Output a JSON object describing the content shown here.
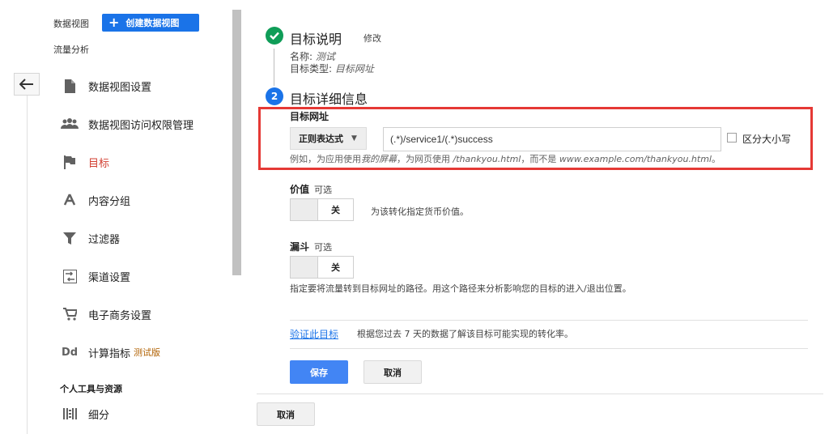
{
  "sidebar": {
    "view_label": "数据视图",
    "create_view_label": "创建数据视图",
    "view_name": "流量分析",
    "items": [
      {
        "label": "数据视图设置",
        "icon": "document-icon"
      },
      {
        "label": "数据视图访问权限管理",
        "icon": "people-icon"
      },
      {
        "label": "目标",
        "icon": "flag-icon"
      },
      {
        "label": "内容分组",
        "icon": "person-walk-icon"
      },
      {
        "label": "过滤器",
        "icon": "filter-icon"
      },
      {
        "label": "渠道设置",
        "icon": "channel-settings-icon"
      },
      {
        "label": "电子商务设置",
        "icon": "cart-icon"
      },
      {
        "label": "计算指标",
        "icon": "dd-icon",
        "badge": "测试版"
      }
    ],
    "personal_section_title": "个人工具与资源",
    "personal_items": [
      {
        "label": "细分",
        "icon": "segments-icon"
      }
    ]
  },
  "goal_description": {
    "title": "目标说明",
    "edit_label": "修改",
    "name_label": "名称:",
    "name_value": "测试",
    "type_label": "目标类型:",
    "type_value": "目标网址"
  },
  "goal_details": {
    "step_number": "2",
    "title": "目标详细信息",
    "destination_label": "目标网址",
    "match_type": "正则表达式",
    "destination_value": "(.*)/service1/(.*)success",
    "case_sensitive_label": "区分大小写",
    "hint_prefix": "例如，为应用使用",
    "hint_app": "我的屏幕",
    "hint_mid": "，为网页使用",
    "hint_page": "/thankyou.html",
    "hint_not": "，而不是",
    "hint_full": "www.example.com/thankyou.html",
    "hint_end": "。",
    "value_label": "价值",
    "value_optional": "可选",
    "value_toggle": "关",
    "value_desc": "为该转化指定货币价值。",
    "funnel_label": "漏斗",
    "funnel_optional": "可选",
    "funnel_toggle": "关",
    "funnel_desc": "指定要将流量转到目标网址的路径。用这个路径来分析影响您的目标的进入/退出位置。",
    "verify_label": "验证此目标",
    "verify_desc": "根据您过去 7 天的数据了解该目标可能实现的转化率。",
    "save_label": "保存",
    "cancel_label": "取消"
  },
  "footer": {
    "cancel_label": "取消"
  },
  "colors": {
    "accent": "#1a73e8",
    "success": "#0f9d58",
    "highlight_box": "#e53935",
    "active_nav": "#d23f31"
  }
}
